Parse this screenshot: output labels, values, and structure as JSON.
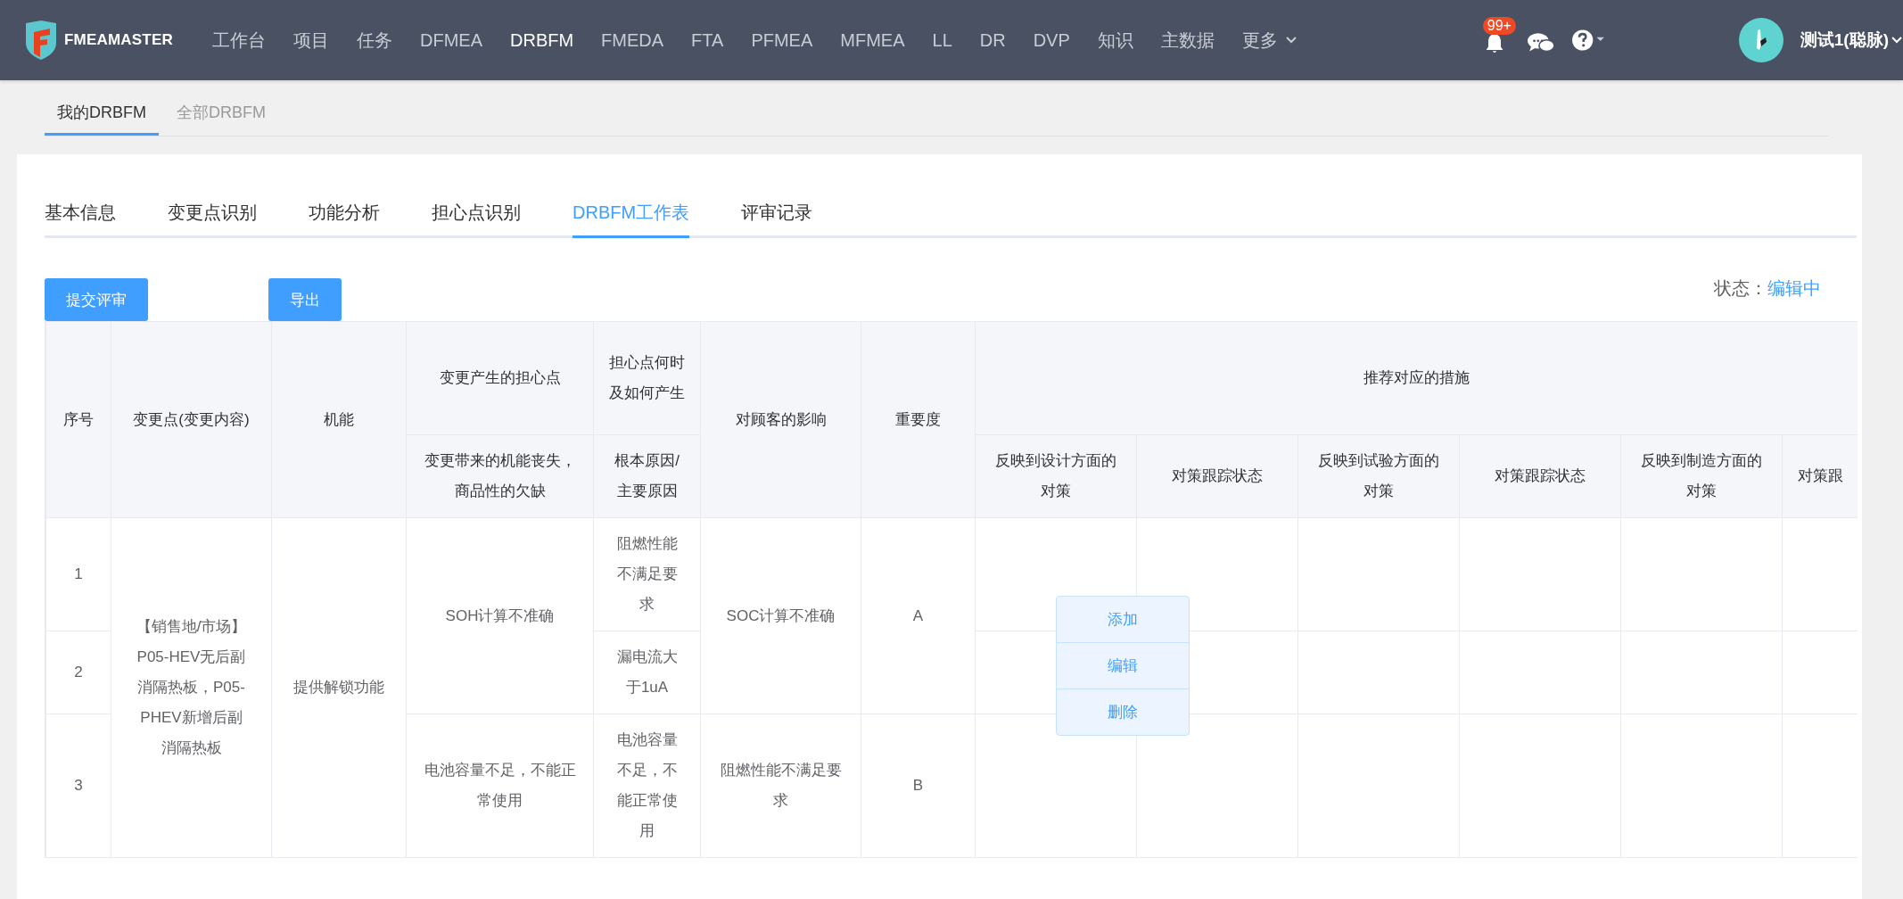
{
  "header": {
    "logo_text": "FMEAMASTER",
    "nav": [
      {
        "label": "工作台",
        "selected": false
      },
      {
        "label": "项目",
        "selected": false
      },
      {
        "label": "任务",
        "selected": false
      },
      {
        "label": "DFMEA",
        "selected": false
      },
      {
        "label": "DRBFM",
        "selected": true
      },
      {
        "label": "FMEDA",
        "selected": false
      },
      {
        "label": "FTA",
        "selected": false
      },
      {
        "label": "PFMEA",
        "selected": false
      },
      {
        "label": "MFMEA",
        "selected": false
      },
      {
        "label": "LL",
        "selected": false
      },
      {
        "label": "DR",
        "selected": false
      },
      {
        "label": "DVP",
        "selected": false
      },
      {
        "label": "知识",
        "selected": false
      },
      {
        "label": "主数据",
        "selected": false
      }
    ],
    "more": "更多",
    "notification_badge": "99+",
    "user_name": "测试1(聪脉)"
  },
  "sub_tabs": [
    {
      "label": "我的DRBFM",
      "selected": true
    },
    {
      "label": "全部DRBFM",
      "selected": false
    }
  ],
  "tabs": [
    {
      "label": "基本信息",
      "selected": false
    },
    {
      "label": "变更点识别",
      "selected": false
    },
    {
      "label": "功能分析",
      "selected": false
    },
    {
      "label": "担心点识别",
      "selected": false
    },
    {
      "label": "DRBFM工作表",
      "selected": true
    },
    {
      "label": "评审记录",
      "selected": false
    }
  ],
  "buttons": [
    {
      "label": "提交评审"
    },
    {
      "label": "导出"
    }
  ],
  "status": {
    "label": "状态：",
    "value": "编辑中"
  },
  "table": {
    "columns": [
      {
        "label": "序号"
      },
      {
        "label": "变更点(变更内容)"
      },
      {
        "label": "机能"
      },
      {
        "label": "变更产生的担心点",
        "sub_label": "变更带来的机能丧失，商品性的欠缺"
      },
      {
        "label": "担心点何时及如何产生",
        "sub_label": "根本原因/主要原因"
      },
      {
        "label": "对顾客的影响"
      },
      {
        "label": "重要度"
      }
    ],
    "measures": {
      "label": "推荐对应的措施",
      "columns": [
        "反映到设计方面的对策",
        "对策跟踪状态",
        "反映到试验方面的对策",
        "对策跟踪状态",
        "反映到制造方面的对策",
        "对策跟"
      ]
    },
    "groups": [
      {
        "change_point": "【销售地/市场】P05-HEV无后副消隔热板，P05-PHEV新增后副消隔热板",
        "function": "提供解锁功能",
        "concerns": [
          {
            "concern": "SOH计算不准确",
            "impact": "SOC计算不准确",
            "severity": "A",
            "causes": [
              {
                "no": "1",
                "cause": "阻燃性能不满足要求"
              },
              {
                "no": "2",
                "cause": "漏电流大于1uA"
              }
            ]
          },
          {
            "concern": "电池容量不足，不能正常使用",
            "impact": "阻燃性能不满足要求",
            "severity": "B",
            "causes": [
              {
                "no": "3",
                "cause": "电池容量不足，不能正常使用"
              }
            ]
          }
        ]
      }
    ]
  },
  "context_menu": [
    "添加",
    "编辑",
    "删除"
  ]
}
